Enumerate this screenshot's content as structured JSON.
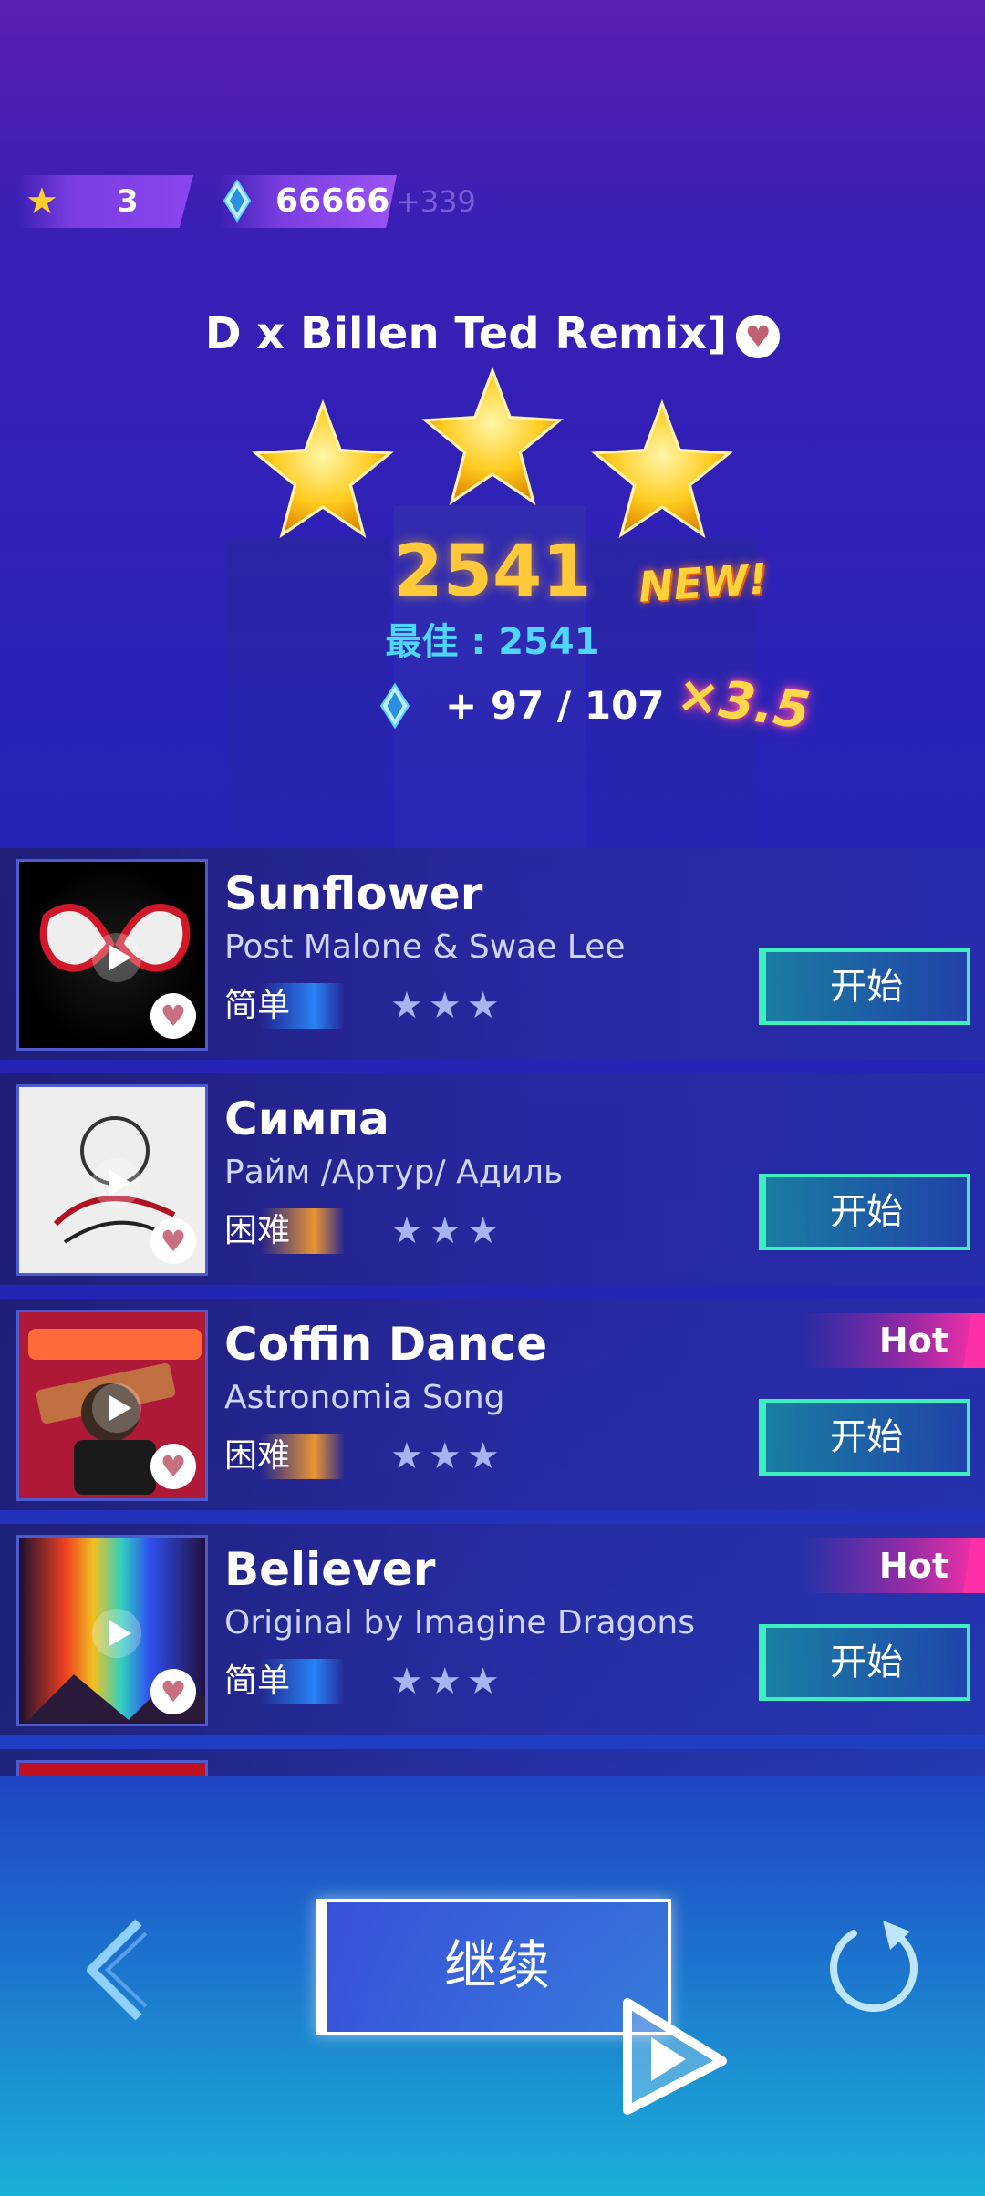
{
  "header": {
    "stars_count": "3",
    "gems_count": "66666",
    "gems_delta": "+339"
  },
  "result": {
    "song_title": "D x Billen Ted Remix]",
    "stars_earned": 3,
    "score": "2541",
    "new_badge": "NEW!",
    "best_label": "最佳 : 2541",
    "gem_reward": "+ 97 / 107",
    "multiplier": "×3.5"
  },
  "songs": [
    {
      "title": "Sunflower",
      "artist": "Post Malone & Swae Lee",
      "difficulty": "简单",
      "difficulty_kind": "easy",
      "stars": "★★★",
      "start_label": "开始",
      "hot": ""
    },
    {
      "title": "Симпа",
      "artist": "Райм /Артур/ Адиль",
      "difficulty": "困难",
      "difficulty_kind": "hard",
      "stars": "★★★",
      "start_label": "开始",
      "hot": ""
    },
    {
      "title": "Coffin Dance",
      "artist": "Astronomia Song",
      "difficulty": "困难",
      "difficulty_kind": "hard",
      "stars": "★★★",
      "start_label": "开始",
      "hot": "Hot"
    },
    {
      "title": "Believer",
      "artist": "Original by Imagine Dragons",
      "difficulty": "简单",
      "difficulty_kind": "easy",
      "stars": "★★★",
      "start_label": "开始",
      "hot": "Hot"
    }
  ],
  "controls": {
    "continue_label": "继续"
  },
  "colors": {
    "accent_gold": "#ffc93a",
    "accent_cyan": "#4ed6ff",
    "start_border": "#3ef0c0",
    "hot_pink": "#ff2fa8"
  },
  "icons": {
    "back": "chevron-left-icon",
    "replay": "replay-icon",
    "gem": "diamond-icon",
    "heart": "heart-icon"
  }
}
